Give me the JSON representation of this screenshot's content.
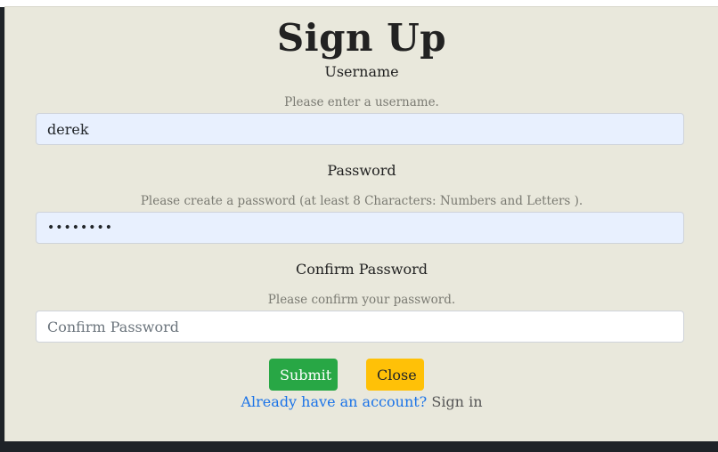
{
  "form": {
    "title": "Sign Up",
    "username": {
      "label": "Username",
      "help": "Please enter a username.",
      "value": "derek"
    },
    "password": {
      "label": "Password",
      "help": "Please create a password (at least 8 Characters: Numbers and Letters ).",
      "value_masked": "••••••••"
    },
    "confirm": {
      "label": "Confirm Password",
      "help": "Please confirm your password.",
      "placeholder": "Confirm Password",
      "value": ""
    },
    "buttons": {
      "submit": "Submit",
      "close": "Close"
    },
    "footer": {
      "already": "Already have an account?",
      "signin": "Sign in"
    }
  },
  "colors": {
    "modal_bg": "#e9e8dc",
    "filled_input_bg": "#e8f0fe",
    "submit": "#28a745",
    "close": "#ffc107",
    "link": "#1a73e8"
  }
}
